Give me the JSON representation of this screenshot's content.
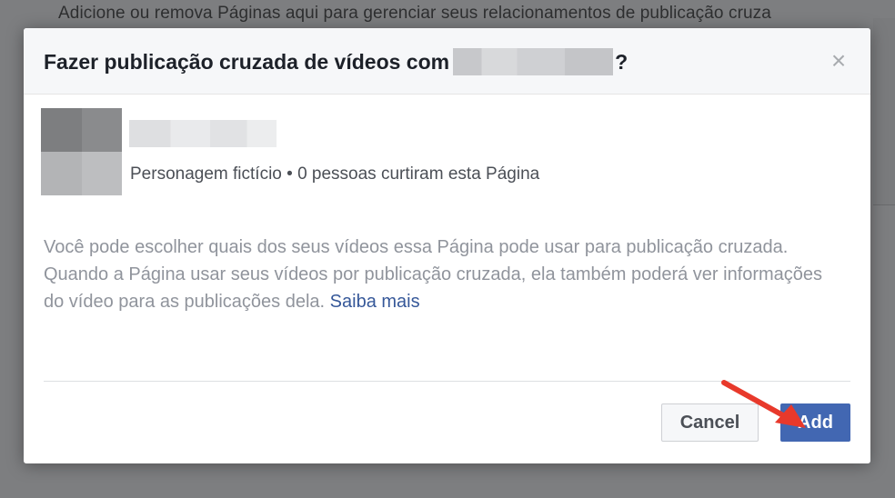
{
  "background": {
    "text": "Adicione ou remova Páginas aqui para gerenciar seus relacionamentos de publicação cruza"
  },
  "dialog": {
    "title_prefix": "Fazer publicação cruzada de vídeos com",
    "title_suffix": "?",
    "close_icon": "close-icon",
    "page": {
      "meta": "Personagem fictício • 0 pessoas curtiram esta Página"
    },
    "description": "Você pode escolher quais dos seus vídeos essa Página pode usar para publicação cruzada. Quando a Página usar seus vídeos por publicação cruzada, ela também poderá ver informações do vídeo para as publicações dela.",
    "learn_more": "Saiba mais",
    "buttons": {
      "cancel": "Cancel",
      "add": "Add"
    }
  },
  "colors": {
    "primary_button": "#4267b2",
    "link": "#365899",
    "annotation_arrow": "#e8392b"
  }
}
